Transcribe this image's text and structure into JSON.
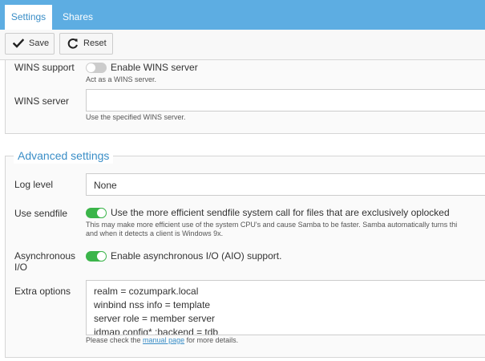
{
  "tabs": [
    {
      "label": "Settings",
      "active": true
    },
    {
      "label": "Shares",
      "active": false
    }
  ],
  "toolbar": {
    "save_label": "Save",
    "reset_label": "Reset"
  },
  "wins_support": {
    "label": "WINS support",
    "toggle_label": "Enable WINS server",
    "enabled": false,
    "help": "Act as a WINS server."
  },
  "wins_server": {
    "label": "WINS server",
    "value": "",
    "help": "Use the specified WINS server."
  },
  "advanced": {
    "title": "Advanced settings",
    "log_level": {
      "label": "Log level",
      "value": "None"
    },
    "use_sendfile": {
      "label": "Use sendfile",
      "toggle_label": "Use the more efficient sendfile system call for files that are exclusively oplocked",
      "enabled": true,
      "help_line1": "This may make more efficient use of the system CPU's and cause Samba to be faster. Samba automatically turns thi",
      "help_line2": "and when it detects a client is Windows 9x."
    },
    "async_io": {
      "label_line1": "Asynchronous",
      "label_line2": "I/O",
      "toggle_label": "Enable asynchronous I/O (AIO) support.",
      "enabled": true
    },
    "extra_options": {
      "label": "Extra options",
      "lines": [
        "realm = cozumpark.local",
        "winbind nss info = template",
        "server role = member server",
        "idmap config* :backend = tdb"
      ],
      "help_before": "Please check the ",
      "help_link": "manual page",
      "help_after": " for more details."
    }
  },
  "colors": {
    "accent": "#5dade2",
    "link": "#3a8ec7",
    "toggle_on": "#3bb54a",
    "toggle_off": "#cccccc"
  },
  "icons": {
    "save": "check-icon",
    "reset": "refresh-icon"
  }
}
